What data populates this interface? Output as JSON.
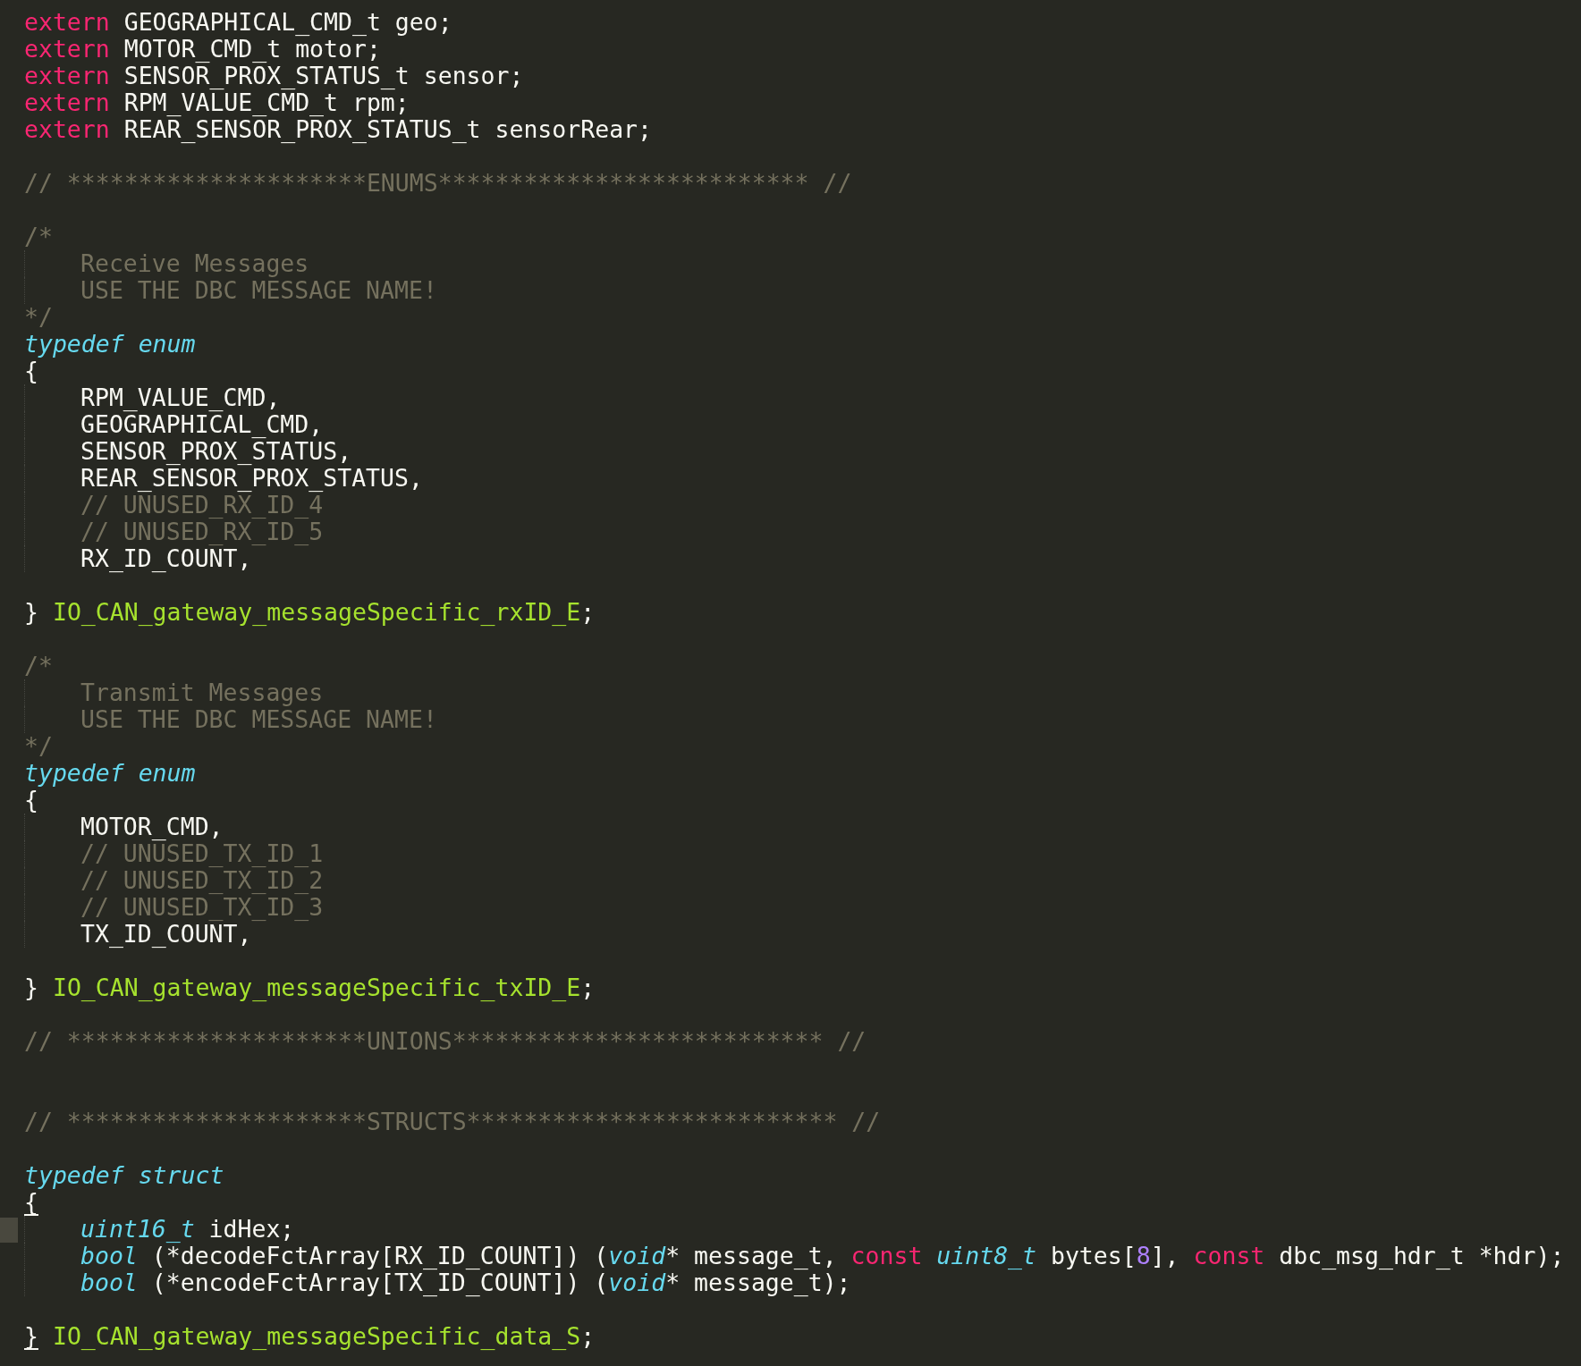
{
  "lines": [
    {
      "kind": "code",
      "tokens": [
        {
          "text": "extern",
          "kind": "keyword"
        },
        {
          "text": " GEOGRAPHICAL_CMD_t geo;",
          "kind": "plain"
        }
      ]
    },
    {
      "kind": "code",
      "tokens": [
        {
          "text": "extern",
          "kind": "keyword"
        },
        {
          "text": " MOTOR_CMD_t motor;",
          "kind": "plain"
        }
      ]
    },
    {
      "kind": "code",
      "tokens": [
        {
          "text": "extern",
          "kind": "keyword"
        },
        {
          "text": " SENSOR_PROX_STATUS_t sensor;",
          "kind": "plain"
        }
      ]
    },
    {
      "kind": "code",
      "tokens": [
        {
          "text": "extern",
          "kind": "keyword"
        },
        {
          "text": " RPM_VALUE_CMD_t rpm;",
          "kind": "plain"
        }
      ]
    },
    {
      "kind": "code",
      "tokens": [
        {
          "text": "extern",
          "kind": "keyword"
        },
        {
          "text": " REAR_SENSOR_PROX_STATUS_t sensorRear;",
          "kind": "plain"
        }
      ]
    },
    {
      "kind": "blank"
    },
    {
      "kind": "code",
      "tokens": [
        {
          "text": "// *********************ENUMS************************** //",
          "kind": "comment"
        }
      ]
    },
    {
      "kind": "blank"
    },
    {
      "kind": "code",
      "tokens": [
        {
          "text": "/*",
          "kind": "comment"
        }
      ]
    },
    {
      "kind": "code",
      "indented": true,
      "tokens": [
        {
          "text": "Receive Messages",
          "kind": "comment"
        }
      ]
    },
    {
      "kind": "code",
      "indented": true,
      "tokens": [
        {
          "text": "USE THE DBC MESSAGE NAME!",
          "kind": "comment"
        }
      ]
    },
    {
      "kind": "code",
      "tokens": [
        {
          "text": "*/",
          "kind": "comment"
        }
      ]
    },
    {
      "kind": "code",
      "tokens": [
        {
          "text": "typedef enum",
          "kind": "storage"
        }
      ]
    },
    {
      "kind": "code",
      "tokens": [
        {
          "text": "{",
          "kind": "plain"
        }
      ]
    },
    {
      "kind": "code",
      "indented": true,
      "tokens": [
        {
          "text": "RPM_VALUE_CMD,",
          "kind": "plain"
        }
      ]
    },
    {
      "kind": "code",
      "indented": true,
      "tokens": [
        {
          "text": "GEOGRAPHICAL_CMD,",
          "kind": "plain"
        }
      ]
    },
    {
      "kind": "code",
      "indented": true,
      "tokens": [
        {
          "text": "SENSOR_PROX_STATUS,",
          "kind": "plain"
        }
      ]
    },
    {
      "kind": "code",
      "indented": true,
      "tokens": [
        {
          "text": "REAR_SENSOR_PROX_STATUS,",
          "kind": "plain"
        }
      ]
    },
    {
      "kind": "code",
      "indented": true,
      "tokens": [
        {
          "text": "// UNUSED_RX_ID_4",
          "kind": "comment"
        }
      ]
    },
    {
      "kind": "code",
      "indented": true,
      "tokens": [
        {
          "text": "// UNUSED_RX_ID_5",
          "kind": "comment"
        }
      ]
    },
    {
      "kind": "code",
      "indented": true,
      "tokens": [
        {
          "text": "RX_ID_COUNT,",
          "kind": "plain"
        }
      ]
    },
    {
      "kind": "blank"
    },
    {
      "kind": "code",
      "tokens": [
        {
          "text": "} ",
          "kind": "plain"
        },
        {
          "text": "IO_CAN_gateway_messageSpecific_rxID_E",
          "kind": "name"
        },
        {
          "text": ";",
          "kind": "plain"
        }
      ]
    },
    {
      "kind": "blank"
    },
    {
      "kind": "code",
      "tokens": [
        {
          "text": "/*",
          "kind": "comment"
        }
      ]
    },
    {
      "kind": "code",
      "indented": true,
      "tokens": [
        {
          "text": "Transmit Messages",
          "kind": "comment"
        }
      ]
    },
    {
      "kind": "code",
      "indented": true,
      "tokens": [
        {
          "text": "USE THE DBC MESSAGE NAME!",
          "kind": "comment"
        }
      ]
    },
    {
      "kind": "code",
      "tokens": [
        {
          "text": "*/",
          "kind": "comment"
        }
      ]
    },
    {
      "kind": "code",
      "tokens": [
        {
          "text": "typedef enum",
          "kind": "storage"
        }
      ]
    },
    {
      "kind": "code",
      "tokens": [
        {
          "text": "{",
          "kind": "plain"
        }
      ]
    },
    {
      "kind": "code",
      "indented": true,
      "tokens": [
        {
          "text": "MOTOR_CMD,",
          "kind": "plain"
        }
      ]
    },
    {
      "kind": "code",
      "indented": true,
      "tokens": [
        {
          "text": "// UNUSED_TX_ID_1",
          "kind": "comment"
        }
      ]
    },
    {
      "kind": "code",
      "indented": true,
      "tokens": [
        {
          "text": "// UNUSED_TX_ID_2",
          "kind": "comment"
        }
      ]
    },
    {
      "kind": "code",
      "indented": true,
      "tokens": [
        {
          "text": "// UNUSED_TX_ID_3",
          "kind": "comment"
        }
      ]
    },
    {
      "kind": "code",
      "indented": true,
      "tokens": [
        {
          "text": "TX_ID_COUNT,",
          "kind": "plain"
        }
      ]
    },
    {
      "kind": "blank"
    },
    {
      "kind": "code",
      "tokens": [
        {
          "text": "} ",
          "kind": "plain"
        },
        {
          "text": "IO_CAN_gateway_messageSpecific_txID_E",
          "kind": "name"
        },
        {
          "text": ";",
          "kind": "plain"
        }
      ]
    },
    {
      "kind": "blank"
    },
    {
      "kind": "code",
      "tokens": [
        {
          "text": "// *********************UNIONS************************** //",
          "kind": "comment"
        }
      ]
    },
    {
      "kind": "blank"
    },
    {
      "kind": "blank"
    },
    {
      "kind": "code",
      "tokens": [
        {
          "text": "// *********************STRUCTS************************** //",
          "kind": "comment"
        }
      ]
    },
    {
      "kind": "blank"
    },
    {
      "kind": "code",
      "tokens": [
        {
          "text": "typedef struct",
          "kind": "storage"
        }
      ]
    },
    {
      "kind": "code",
      "tokens": [
        {
          "text": "{",
          "kind": "plain",
          "matched": true
        }
      ]
    },
    {
      "kind": "code",
      "indented": true,
      "marked": true,
      "tokens": [
        {
          "text": "uint16_t",
          "kind": "storage"
        },
        {
          "text": " idHex;",
          "kind": "plain"
        }
      ]
    },
    {
      "kind": "code",
      "indented": true,
      "tokens": [
        {
          "text": "bool",
          "kind": "storage"
        },
        {
          "text": " (*decodeFctArray[RX_ID_COUNT]) (",
          "kind": "plain"
        },
        {
          "text": "void",
          "kind": "storage"
        },
        {
          "text": "* message_t, ",
          "kind": "plain"
        },
        {
          "text": "const",
          "kind": "keyword"
        },
        {
          "text": " uint8_t",
          "kind": "storage"
        },
        {
          "text": " bytes[",
          "kind": "plain"
        },
        {
          "text": "8",
          "kind": "number"
        },
        {
          "text": "], ",
          "kind": "plain"
        },
        {
          "text": "const",
          "kind": "keyword"
        },
        {
          "text": " dbc_msg_hdr_t *hdr);",
          "kind": "plain"
        }
      ]
    },
    {
      "kind": "code",
      "indented": true,
      "tokens": [
        {
          "text": "bool",
          "kind": "storage"
        },
        {
          "text": " (*encodeFctArray[TX_ID_COUNT]) (",
          "kind": "plain"
        },
        {
          "text": "void",
          "kind": "storage"
        },
        {
          "text": "* message_t);",
          "kind": "plain"
        }
      ]
    },
    {
      "kind": "blank"
    },
    {
      "kind": "code",
      "tokens": [
        {
          "text": "}",
          "kind": "plain",
          "matched": true
        },
        {
          "text": " IO_CAN_gateway_messageSpecific_data_S",
          "kind": "name"
        },
        {
          "text": ";",
          "kind": "plain"
        }
      ]
    }
  ]
}
